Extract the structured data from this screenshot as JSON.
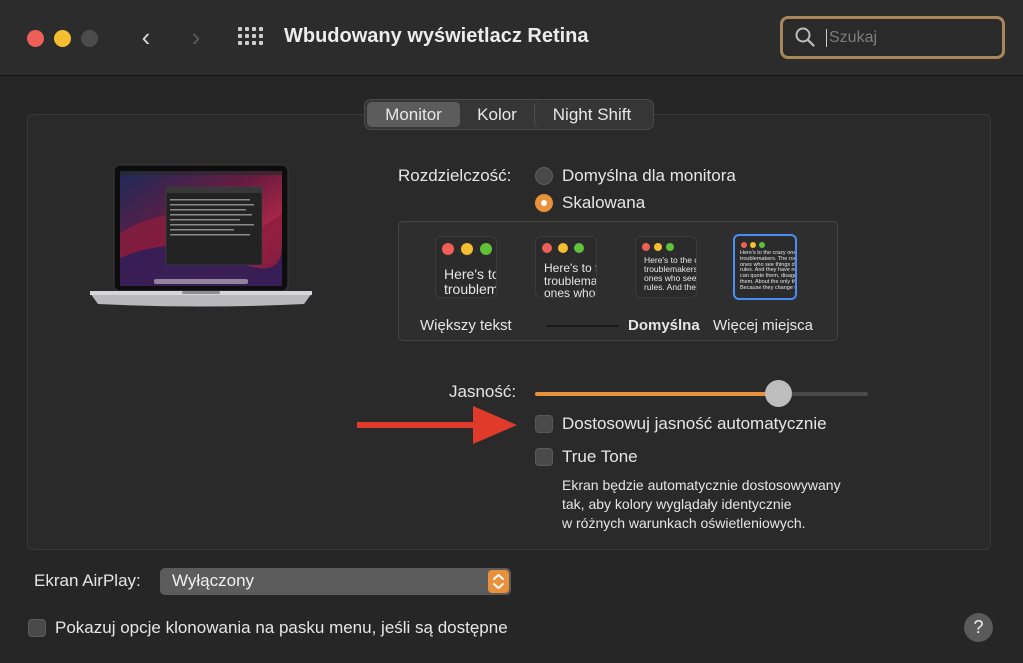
{
  "window": {
    "title": "Wbudowany wyświetlacz Retina",
    "search_placeholder": "Szukaj"
  },
  "icons": {
    "back": "‹",
    "forward": "›",
    "help": "?"
  },
  "tabs": [
    {
      "label": "Monitor",
      "active": true
    },
    {
      "label": "Kolor",
      "active": false
    },
    {
      "label": "Night Shift",
      "active": false
    }
  ],
  "resolution": {
    "label": "Rozdzielczość:",
    "options": [
      {
        "label": "Domyślna dla monitora",
        "selected": false
      },
      {
        "label": "Skalowana",
        "selected": true
      }
    ],
    "scale_options": [
      {
        "label": "Większy tekst",
        "preview_text": "Here's to\ntroublem",
        "selected": false
      },
      {
        "label": "",
        "preview_text": "Here's to t\ntroublema\nones who",
        "selected": false
      },
      {
        "label": "Domyślna",
        "preview_text": "Here's to the cr\ntroublemakers.\nones who see t\nrules. And they",
        "selected": false
      },
      {
        "label": "Więcej miejsca",
        "preview_text": "Here's to the crazy ones\ntroublemakers. The rou\nones who see things di\nrules. And they have no\ncan quote them, disagr\nthem. About the only th\nBecause they change th",
        "selected": true
      }
    ]
  },
  "brightness": {
    "label": "Jasność:",
    "level": 0.73
  },
  "auto_brightness": {
    "label": "Dostosowuj jasność automatycznie",
    "checked": false
  },
  "true_tone": {
    "label": "True Tone",
    "checked": false,
    "description": [
      "Ekran będzie automatycznie dostosowywany",
      "tak, aby kolory wyglądały identycznie",
      "w różnych warunkach oświetleniowych."
    ]
  },
  "airplay": {
    "label": "Ekran AirPlay:",
    "value": "Wyłączony"
  },
  "mirroring": {
    "label": "Pokazuj opcje klonowania na pasku menu, jeśli są dostępne",
    "checked": false
  },
  "colors": {
    "accent": "#e8913a",
    "selection": "#4a8ef5",
    "annotation_arrow": "#e03a2a"
  }
}
